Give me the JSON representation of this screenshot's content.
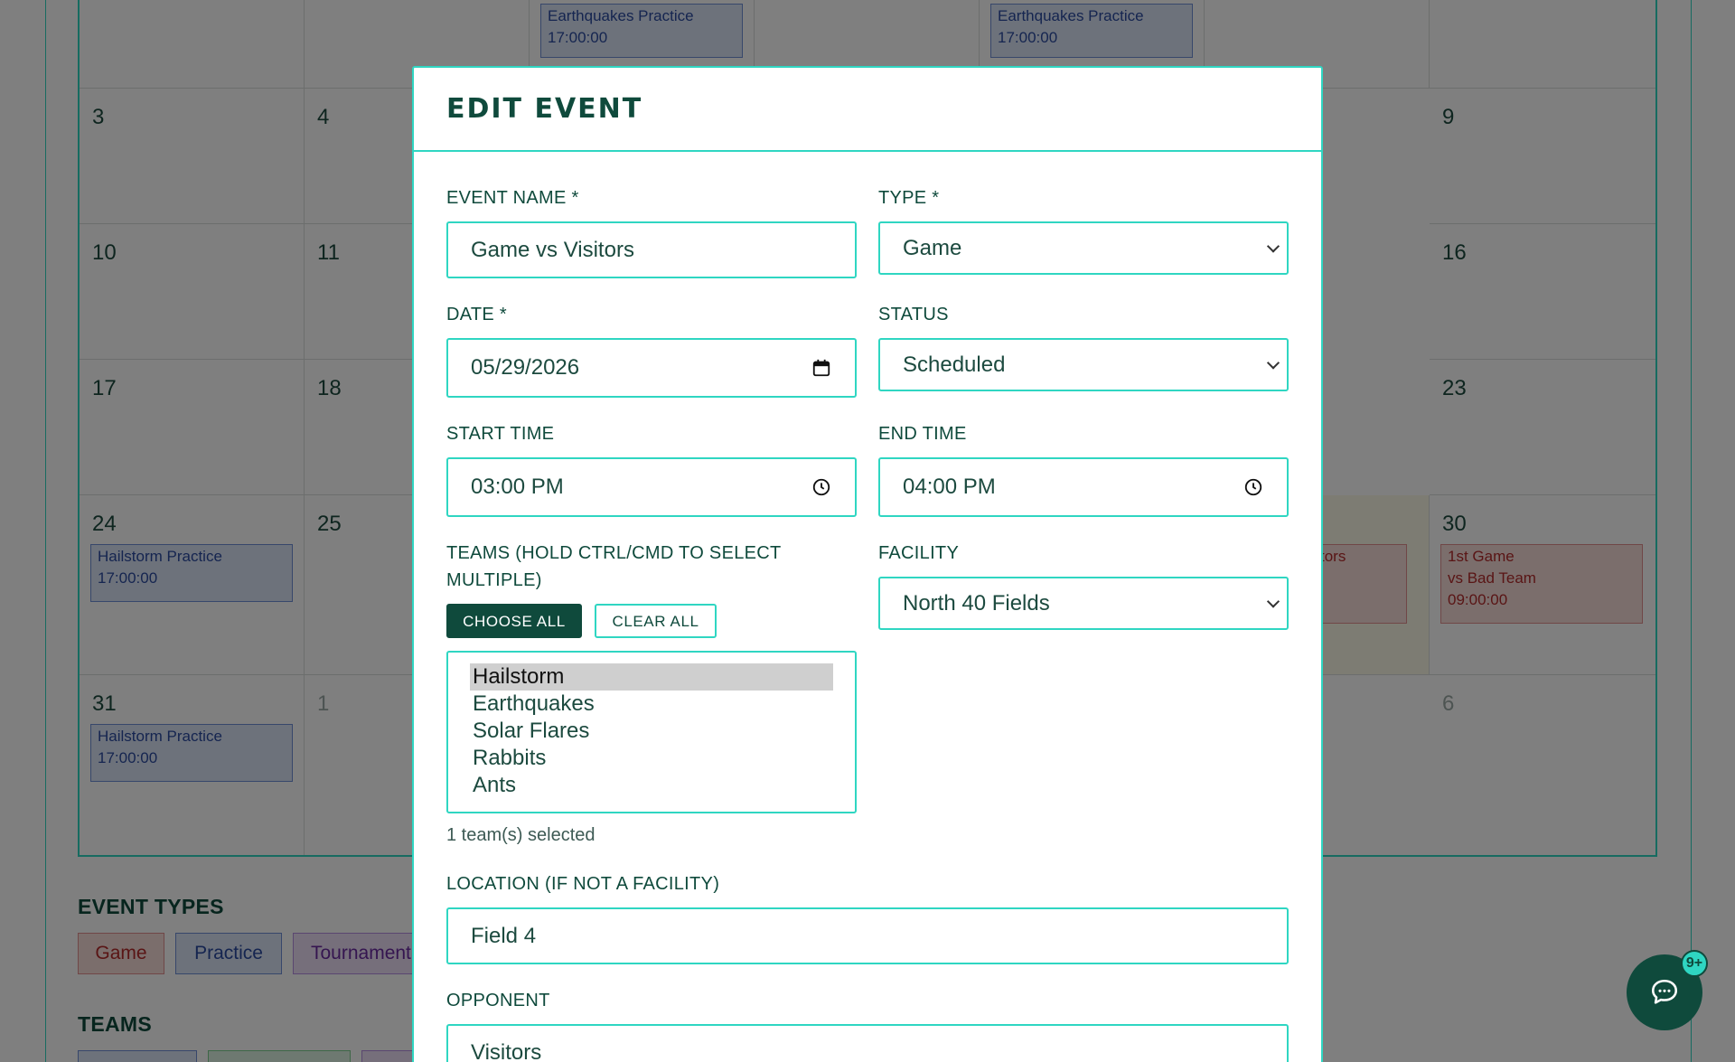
{
  "calendar": {
    "top_events": [
      {
        "title": "Earthquakes Practice",
        "time": "17:00:00"
      },
      {
        "title": "Earthquakes Practice",
        "time": "17:00:00"
      }
    ],
    "days": {
      "d3": "3",
      "d4": "4",
      "d9": "9",
      "d10": "10",
      "d11": "11",
      "d16": "16",
      "d17": "17",
      "d18": "18",
      "d23": "23",
      "d24": "24",
      "d25": "25",
      "d30": "30",
      "d31": "31",
      "d1": "1",
      "d6": "6"
    },
    "events": {
      "hailstorm_24": {
        "title": "Hailstorm Practice",
        "time": "17:00:00"
      },
      "hailstorm_31": {
        "title": "Hailstorm Practice",
        "time": "17:00:00"
      },
      "partial_29": "tors",
      "game_30": {
        "line1": "1st Game",
        "line2": "vs Bad Team",
        "time": "09:00:00"
      }
    }
  },
  "legend": {
    "event_types_title": "EVENT TYPES",
    "types": [
      "Game",
      "Practice",
      "Tournament"
    ],
    "teams_title": "TEAMS"
  },
  "modal": {
    "title": "EDIT EVENT",
    "event_name_label": "EVENT NAME *",
    "event_name_value": "Game vs Visitors",
    "type_label": "TYPE *",
    "type_value": "Game",
    "date_label": "DATE *",
    "date_value": "05/29/2026",
    "status_label": "STATUS",
    "status_value": "Scheduled",
    "start_time_label": "START TIME",
    "start_time_value": "03:00 PM",
    "end_time_label": "END TIME",
    "end_time_value": "04:00 PM",
    "teams_label_line1": "TEAMS (HOLD CTRL/CMD TO SELECT",
    "teams_label_line2": "MULTIPLE)",
    "choose_all": "CHOOSE ALL",
    "clear_all": "CLEAR ALL",
    "team_options": [
      "Hailstorm",
      "Earthquakes",
      "Solar Flares",
      "Rabbits",
      "Ants"
    ],
    "teams_selected_text": "1 team(s) selected",
    "facility_label": "FACILITY",
    "facility_value": "North 40 Fields",
    "location_label": "LOCATION (IF NOT A FACILITY)",
    "location_value": "Field 4",
    "opponent_label": "OPPONENT",
    "opponent_value": "Visitors"
  },
  "chat": {
    "badge": "9+",
    "icon": "chat-bubble-icon"
  },
  "colors": {
    "accent": "#2fd6c2",
    "primary": "#0f4a3c",
    "game": "#b32a2a",
    "practice": "#2a4aa0",
    "tournament": "#6a2aa0"
  }
}
